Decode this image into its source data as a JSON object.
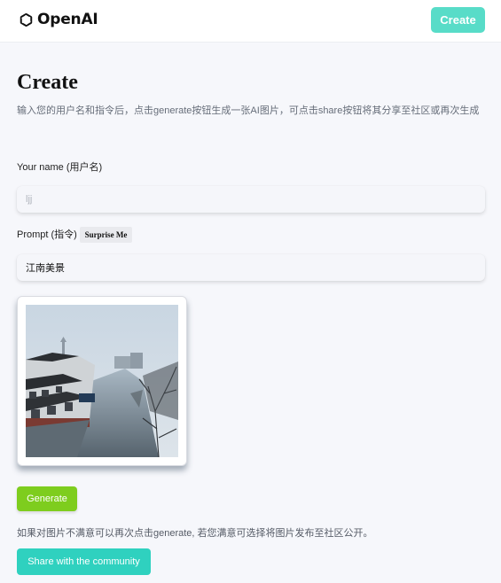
{
  "header": {
    "brand": "OpenAI",
    "logo_icon": "openai-logo-icon",
    "create_label": "Create"
  },
  "main": {
    "title": "Create",
    "subtitle": "输入您的用户名和指令后，点击generate按钮生成一张AI图片，可点击share按钮将其分享至社区或再次生成"
  },
  "form": {
    "name_label": "Your name (用户名)",
    "name_value": "",
    "name_placeholder": "ljj",
    "prompt_label": "Prompt (指令)",
    "surprise_label": "Surprise Me",
    "prompt_value": "江南美景"
  },
  "preview": {
    "image_alt": "Jiangnan water town canal scene"
  },
  "actions": {
    "generate_label": "Generate",
    "hint": "如果对图片不满意可以再次点击generate, 若您满意可选择将图片发布至社区公开。",
    "share_label": "Share with the community"
  },
  "colors": {
    "create_button": "#58dcc8",
    "generate_button": "#7ecd1e",
    "share_button": "#2fd1bf",
    "page_background": "#f6f7fb"
  }
}
